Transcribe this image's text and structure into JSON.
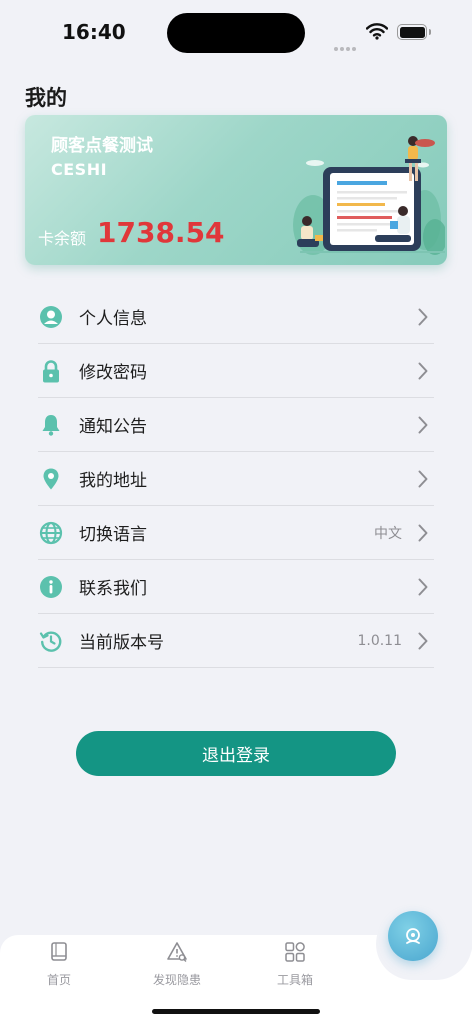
{
  "status_bar": {
    "time": "16:40"
  },
  "page": {
    "title": "我的"
  },
  "card": {
    "name": "顾客点餐测试",
    "code": "CESHI",
    "balance_label": "卡余额",
    "balance_value": "1738.54"
  },
  "menu": {
    "items": [
      {
        "label": "个人信息",
        "value": "",
        "icon": "user-circle-icon"
      },
      {
        "label": "修改密码",
        "value": "",
        "icon": "lock-icon"
      },
      {
        "label": "通知公告",
        "value": "",
        "icon": "bell-icon"
      },
      {
        "label": "我的地址",
        "value": "",
        "icon": "location-pin-icon"
      },
      {
        "label": "切换语言",
        "value": "中文",
        "icon": "globe-icon"
      },
      {
        "label": "联系我们",
        "value": "",
        "icon": "info-icon"
      },
      {
        "label": "当前版本号",
        "value": "1.0.11",
        "icon": "version-history-icon"
      }
    ]
  },
  "logout": {
    "label": "退出登录"
  },
  "tabbar": {
    "tabs": [
      {
        "label": "首页",
        "icon": "book-icon"
      },
      {
        "label": "发现隐患",
        "icon": "warning-search-icon"
      },
      {
        "label": "工具箱",
        "icon": "toolbox-grid-icon"
      }
    ]
  },
  "colors": {
    "accent": "#149584",
    "icon_teal": "#5bc1ad",
    "balance_red": "#e0373a"
  }
}
